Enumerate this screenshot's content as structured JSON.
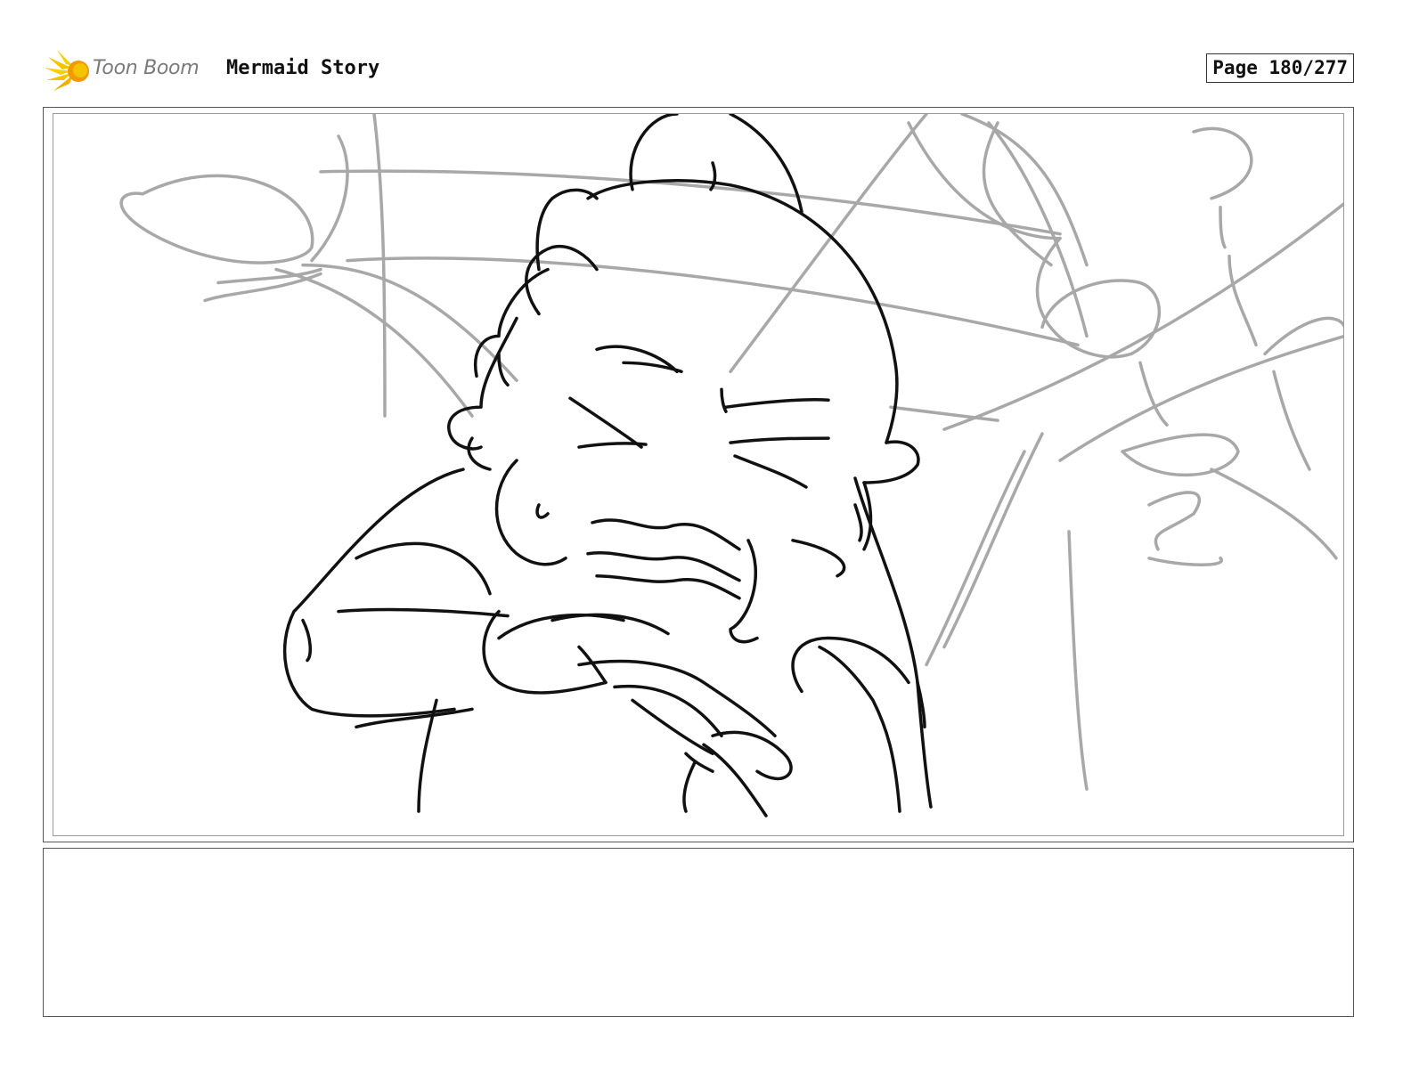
{
  "header": {
    "logo_text": "Toon Boom",
    "project_title": "Mermaid Story",
    "page_label": "Page 180/277"
  },
  "panel": {
    "image_icon": "storyboard-sketch-character-wincing"
  },
  "notes": {
    "text": ""
  },
  "colors": {
    "logo_yellow": "#f5c400",
    "logo_orange": "#f29a00",
    "sketch_dark": "#111111",
    "sketch_light": "#a8a8a8"
  }
}
